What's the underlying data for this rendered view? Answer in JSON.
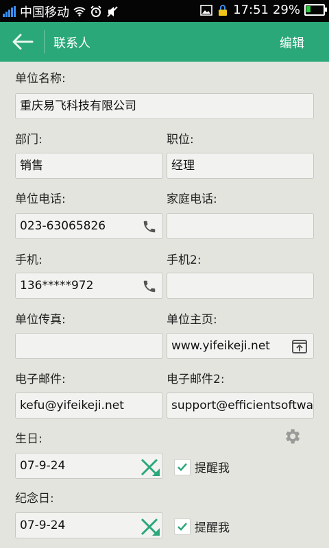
{
  "status": {
    "carrier": "中国移动",
    "time": "17:51",
    "battery": "29%",
    "battery_level": 0.29,
    "icons": [
      "signal-icon",
      "wifi-icon",
      "alarm-icon",
      "mute-icon",
      "image-icon",
      "lock-icon",
      "battery-icon"
    ]
  },
  "appbar": {
    "title": "联系人",
    "edit_label": "编辑",
    "color": "#2ba87a"
  },
  "form": {
    "company_label": "单位名称:",
    "company_value": "重庆易飞科技有限公司",
    "dept_label": "部门:",
    "dept_value": "销售",
    "position_label": "职位:",
    "position_value": "经理",
    "work_phone_label": "单位电话:",
    "work_phone_value": "023-63065826",
    "home_phone_label": "家庭电话:",
    "home_phone_value": "",
    "mobile_label": "手机:",
    "mobile_value": "136*****972",
    "mobile2_label": "手机2:",
    "mobile2_value": "",
    "fax_label": "单位传真:",
    "fax_value": "",
    "homepage_label": "单位主页:",
    "homepage_value": "www.yifeikeji.net",
    "email_label": "电子邮件:",
    "email_value": "kefu@yifeikeji.net",
    "email2_label": "电子邮件2:",
    "email2_value": "support@efficientsoftwa",
    "birthday_label": "生日:",
    "birthday_value": "07-9-24",
    "birthday_remind": "提醒我",
    "anniversary_label": "纪念日:",
    "anniversary_value": "07-9-24",
    "anniversary_remind": "提醒我"
  }
}
